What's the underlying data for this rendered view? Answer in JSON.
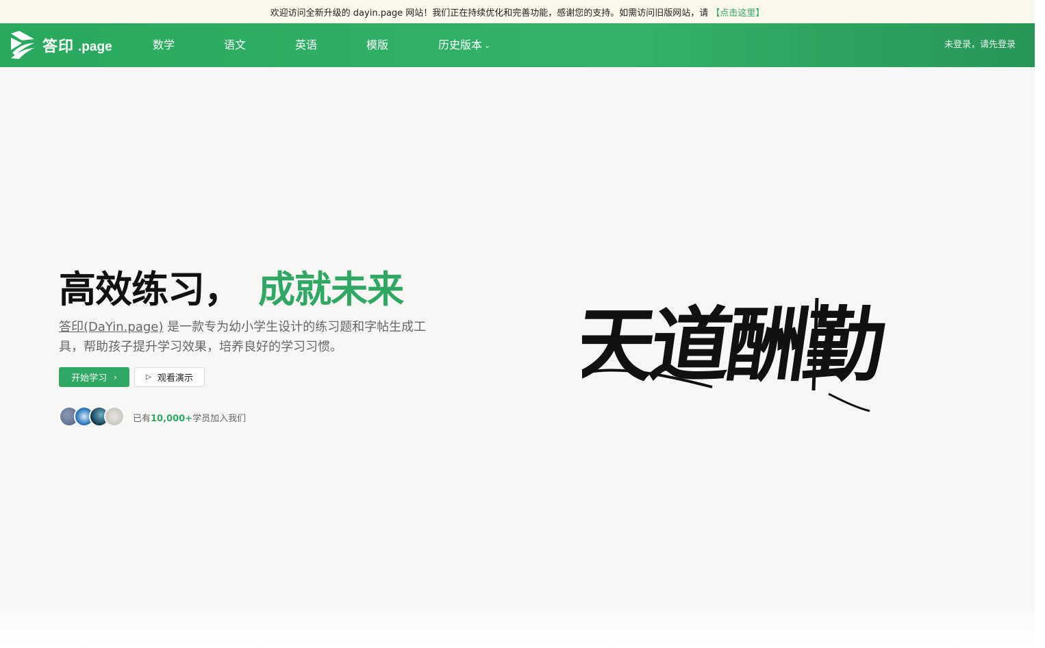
{
  "announcement": {
    "text": "欢迎访问全新升级的 dayin.page 网站！我们正在持续优化和完善功能，感谢您的支持。如需访问旧版网站，请",
    "link": "【点击这里】"
  },
  "header": {
    "logo_text": "答印",
    "logo_suffix": ".page",
    "nav": [
      "数学",
      "语文",
      "英语",
      "模版",
      "历史版本"
    ],
    "login": "未登录，请先登录"
  },
  "hero": {
    "headline_main": "高效练习，",
    "headline_accent": "成就未来",
    "description_brand": "答印(DaYin.page)",
    "description_rest": " 是一款专为幼小学生设计的练习题和字帖生成工具，帮助孩子提升学习效果，培养良好的学习习惯。",
    "primary_button": "开始学习",
    "secondary_button": "观看演示",
    "members_prefix": "已有",
    "members_count": "10,000+",
    "members_suffix": "学员加入我们",
    "calligraphy": "天道酬勤"
  },
  "colors": {
    "accent": "#2ea862",
    "navbar": "#29a95e",
    "announcement_bg": "#fdf8ec",
    "hero_bg": "#f9f7f5"
  },
  "icons": [
    "logo-icon",
    "chevron-down-icon",
    "chevron-right-icon",
    "play-icon"
  ]
}
